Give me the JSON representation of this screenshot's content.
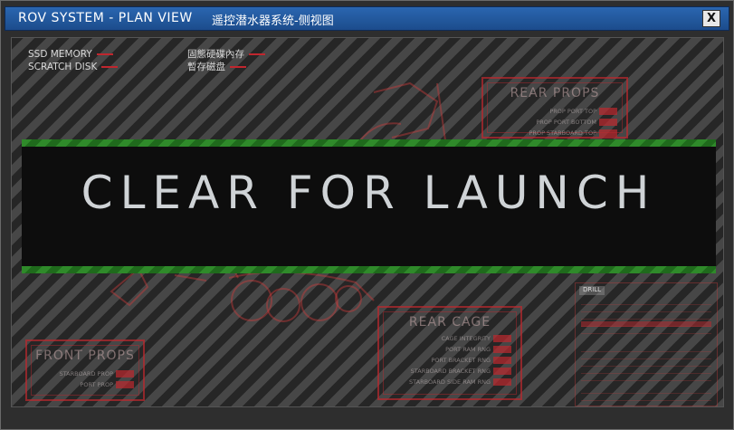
{
  "window": {
    "title_en": "ROV SYSTEM - PLAN VIEW",
    "title_cn": "遥控潜水器系统-侧视图",
    "close_label": "X"
  },
  "legend": {
    "items_en": [
      "SSD MEMORY",
      "SCRATCH DISK"
    ],
    "items_cn": [
      "固態硬碟內存",
      "暫存磁盘"
    ]
  },
  "panels": {
    "rear_props": {
      "title": "REAR PROPS",
      "rows": [
        "PROP PORT TOP",
        "PROP PORT BOTTOM",
        "PROP STARBOARD TOP"
      ]
    },
    "rear_cage": {
      "title": "REAR CAGE",
      "rows": [
        "CAGE INTEGRITY",
        "PORT RAM RNG",
        "PORT BRACKET RNG",
        "STARBOARD BRACKET RNG",
        "STARBOARD SIDE RAM RNG"
      ]
    },
    "front_props": {
      "title": "FRONT PROPS",
      "rows": [
        "STARBOARD PROP",
        "PORT PROP"
      ]
    }
  },
  "data_list": {
    "header": "DRILL"
  },
  "banner": {
    "text": "CLEAR FOR LAUNCH"
  },
  "colors": {
    "accent_red": "#c0262e",
    "banner_green": "#2f8a2a",
    "titlebar_blue": "#2a66b0"
  }
}
